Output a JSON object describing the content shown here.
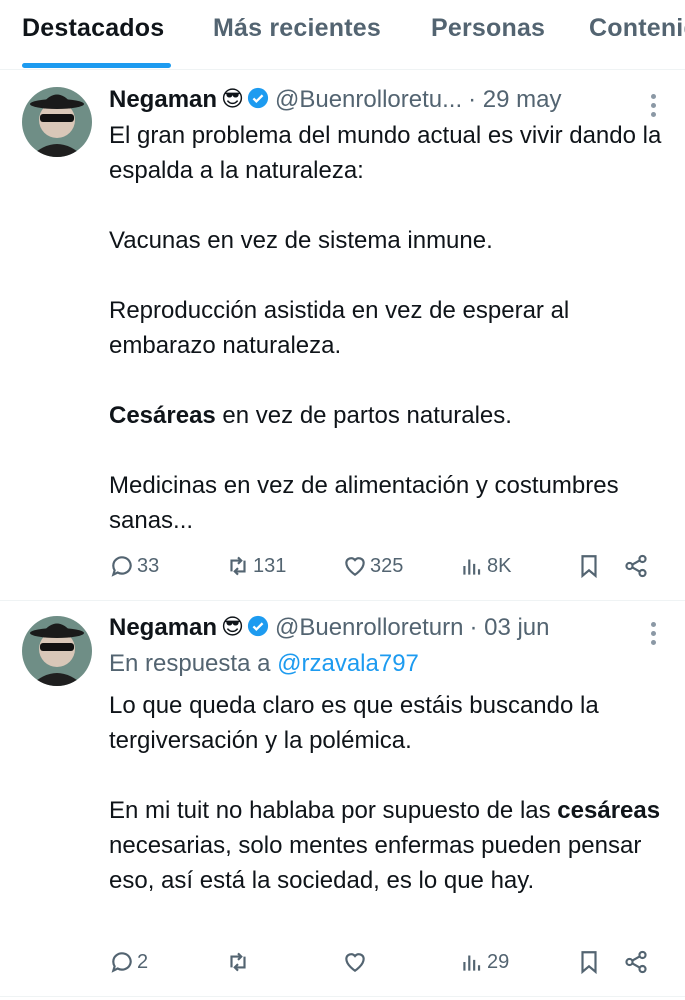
{
  "tabs": [
    {
      "label": "Destacados",
      "active": true
    },
    {
      "label": "Más recientes",
      "active": false
    },
    {
      "label": "Personas",
      "active": false
    },
    {
      "label": "Contenido",
      "active": false
    }
  ],
  "tweets": [
    {
      "name": "Negaman",
      "emoji": "😎",
      "verified": true,
      "handle": "@Buenrolloretu...",
      "date": "· 29 may",
      "reply_prefix": "",
      "reply_mention": "",
      "paragraphs": [
        "El gran problema del mundo actual es vivir dando la espalda a la naturaleza:",
        "Vacunas en vez de sistema inmune.",
        "Reproducción asistida en vez de esperar al embarazo naturaleza."
      ],
      "bold_line": {
        "bold": "Cesáreas",
        "rest": " en vez de partos naturales."
      },
      "last_paragraph": "Medicinas en vez de alimentación y costumbres sanas...",
      "replies": "33",
      "retweets": "131",
      "likes": "325",
      "views": "8K"
    },
    {
      "name": "Negaman",
      "emoji": "😎",
      "verified": true,
      "handle": "@Buenrolloreturn",
      "date": "· 03 jun",
      "reply_prefix": "En respuesta a ",
      "reply_mention": "@rzavala797",
      "p1": "Lo que queda claro es que estáis buscando la tergiversación y la polémica.",
      "p2_before": "En mi tuit no hablaba por supuesto de las ",
      "p2_bold": "cesáreas",
      "p2_after": " necesarias, solo mentes enfermas pueden pensar eso, así está la sociedad, es lo que hay.",
      "replies": "2",
      "retweets": "",
      "likes": "",
      "views": "29"
    }
  ],
  "colors": {
    "accent": "#1d9bf0",
    "muted": "#536471",
    "text": "#0f1419"
  },
  "icons": [
    "reply-icon",
    "retweet-icon",
    "like-icon",
    "views-icon",
    "bookmark-icon",
    "share-icon",
    "verified-icon",
    "more-icon"
  ]
}
